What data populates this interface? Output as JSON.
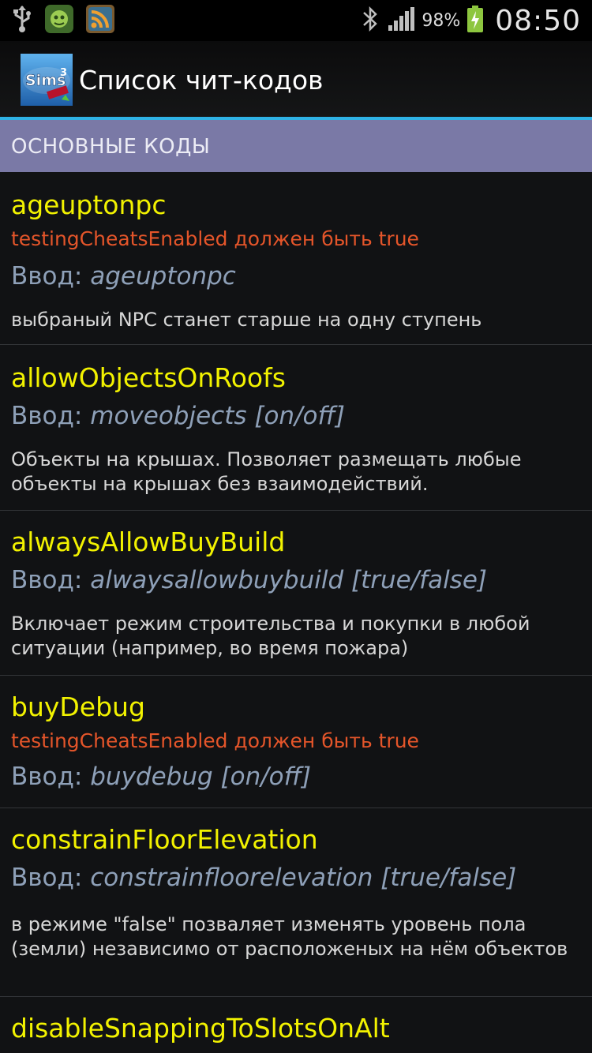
{
  "status_bar": {
    "battery_percent": "98%",
    "time": "08:50",
    "icons": [
      "usb-icon",
      "shield-app-icon",
      "rss-icon",
      "bluetooth-icon",
      "signal-icon",
      "battery-charging-icon"
    ]
  },
  "action_bar": {
    "app_icon_text": "SIMS 3",
    "title": "Список чит-кодов"
  },
  "section": {
    "title": "ОСНОВНЫЕ КОДЫ"
  },
  "items": [
    {
      "name": "ageuptonpc",
      "warning": "testingCheatsEnabled должен быть true",
      "input_label": "Ввод: ",
      "input_cmd": "ageuptonpc",
      "description": "выбраный NPC станет старше на одну ступень"
    },
    {
      "name": "allowObjectsOnRoofs",
      "warning": "",
      "input_label": "Ввод: ",
      "input_cmd": "moveobjects [on/off]",
      "description": "Объекты на крышах. Позволяет размещать любые объекты на крышах без взаимодействий."
    },
    {
      "name": "alwaysAllowBuyBuild",
      "warning": "",
      "input_label": "Ввод: ",
      "input_cmd": "alwaysallowbuybuild [true/false]",
      "description": "Включает режим строительства и покупки в любой ситуации (например, во время пожара)"
    },
    {
      "name": "buyDebug",
      "warning": "testingCheatsEnabled должен быть true",
      "input_label": "Ввод: ",
      "input_cmd": "buydebug [on/off]",
      "description": ""
    },
    {
      "name": "constrainFloorElevation",
      "warning": "",
      "input_label": "Ввод: ",
      "input_cmd": "constrainfloorelevation [true/false]",
      "description": "в режиме \"false\" позваляет изменять уровень пола (земли) независимо от расположеных на нём объектов"
    },
    {
      "name": "disableSnappingToSlotsOnAlt",
      "warning": "",
      "input_label": "",
      "input_cmd": "",
      "description": ""
    }
  ],
  "colors": {
    "accent_divider": "#2fb3e6",
    "section_bg": "#7a79a6",
    "name": "#f2f200",
    "warning": "#e4552a",
    "input": "#8ea0b8"
  }
}
